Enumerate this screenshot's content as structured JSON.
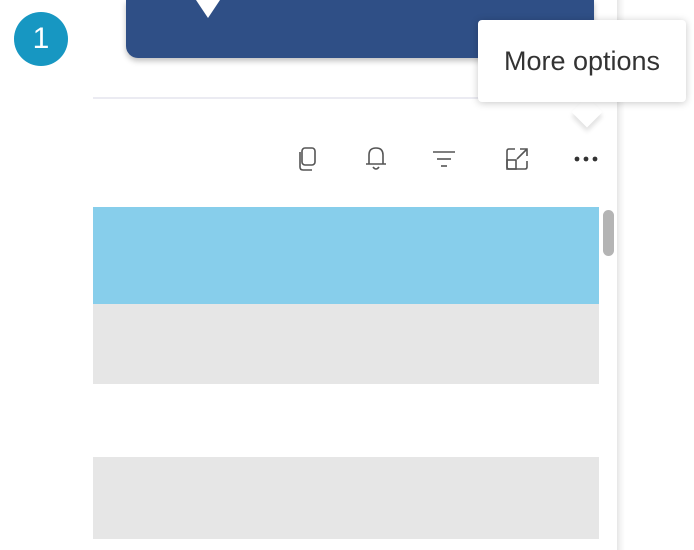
{
  "step_badge": {
    "number": "1",
    "color": "#1797c2"
  },
  "header_card": {
    "color": "#2f4f86"
  },
  "toolbar": {
    "icons": [
      {
        "name": "copy-icon"
      },
      {
        "name": "bell-icon"
      },
      {
        "name": "filter-icon"
      },
      {
        "name": "expand-icon"
      },
      {
        "name": "more-options-icon"
      }
    ]
  },
  "tooltip": {
    "text": "More options"
  },
  "table": {
    "rows": [
      {
        "highlight": true,
        "color": "#87ceeb"
      },
      {
        "highlight": false,
        "color": "#e6e6e6"
      },
      {
        "highlight": false,
        "color": "#ffffff"
      },
      {
        "highlight": false,
        "color": "#e6e6e6"
      }
    ]
  }
}
